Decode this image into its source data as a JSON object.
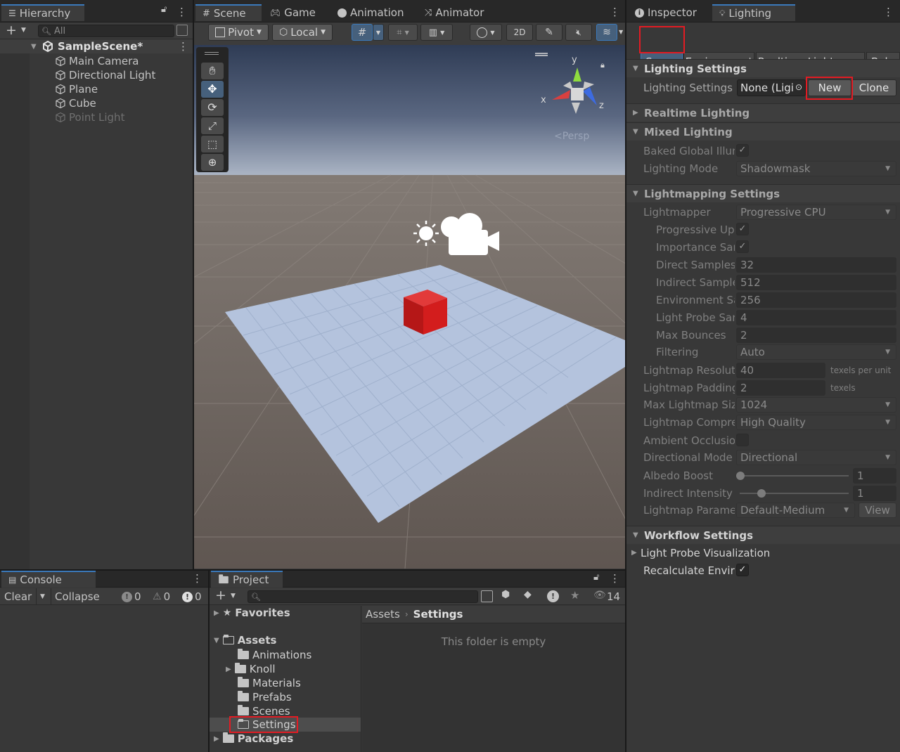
{
  "hierarchy": {
    "tab_label": "Hierarchy",
    "search_placeholder": "All",
    "scene_name": "SampleScene*",
    "items": [
      "Main Camera",
      "Directional Light",
      "Plane",
      "Cube",
      "Point Light"
    ]
  },
  "scene_tabs": {
    "scene": "Scene",
    "game": "Game",
    "animation": "Animation",
    "animator": "Animator"
  },
  "scene_toolbar": {
    "pivot": "Pivot",
    "local": "Local",
    "mode_2d": "2D"
  },
  "scene_view": {
    "persp_label": "<Persp",
    "axis_x": "x",
    "axis_y": "y",
    "axis_z": "z"
  },
  "inspector_tabs": {
    "inspector": "Inspector",
    "lighting": "Lighting"
  },
  "lighting": {
    "tabs": [
      "Scene",
      "Environment",
      "Realtime Lightmaps",
      "Bake"
    ],
    "sections": {
      "lighting_settings": "Lighting Settings",
      "realtime_lighting": "Realtime Lighting",
      "mixed_lighting": "Mixed Lighting",
      "lightmapping_settings": "Lightmapping Settings",
      "workflow_settings": "Workflow Settings"
    },
    "lighting_settings_asset": {
      "label": "Lighting Settings A",
      "value": "None (Ligi",
      "new_btn": "New",
      "clone_btn": "Clone"
    },
    "baked_gi_label": "Baked Global Illum",
    "lighting_mode": {
      "label": "Lighting Mode",
      "value": "Shadowmask"
    },
    "lightmapper": {
      "label": "Lightmapper",
      "value": "Progressive CPU"
    },
    "progressive_updates_label": "Progressive Up",
    "importance_sampling_label": "Importance Sar",
    "direct_samples": {
      "label": "Direct Samples",
      "value": "32"
    },
    "indirect_samples": {
      "label": "Indirect Sample",
      "value": "512"
    },
    "environment_samples": {
      "label": "Environment Sa",
      "value": "256"
    },
    "light_probe_samples": {
      "label": "Light Probe Sar",
      "value": "4"
    },
    "max_bounces": {
      "label": "Max Bounces",
      "value": "2"
    },
    "filtering": {
      "label": "Filtering",
      "value": "Auto"
    },
    "lightmap_resolution": {
      "label": "Lightmap Resoluti",
      "value": "40",
      "unit": "texels per unit"
    },
    "lightmap_padding": {
      "label": "Lightmap Padding",
      "value": "2",
      "unit": "texels"
    },
    "max_lightmap_size": {
      "label": "Max Lightmap Siz",
      "value": "1024"
    },
    "lightmap_compression": {
      "label": "Lightmap Compre",
      "value": "High Quality"
    },
    "ambient_occlusion_label": "Ambient Occlusior",
    "directional_mode": {
      "label": "Directional Mode",
      "value": "Directional"
    },
    "albedo_boost": {
      "label": "Albedo Boost",
      "value": "1",
      "slider_fraction": 0.0
    },
    "indirect_intensity": {
      "label": "Indirect Intensity",
      "value": "1",
      "slider_fraction": 0.2
    },
    "lightmap_parameters": {
      "label": "Lightmap Paramet",
      "value": "Default-Medium",
      "view_btn": "View"
    },
    "light_probe_viz_label": "Light Probe Visualization",
    "recalculate_env_label": "Recalculate Envir"
  },
  "console": {
    "tab_label": "Console",
    "clear_btn": "Clear",
    "collapse_btn": "Collapse",
    "log_count": "0",
    "warning_count": "0",
    "error_count": "0"
  },
  "project": {
    "tab_label": "Project",
    "hidden_count": "14",
    "favorites": "Favorites",
    "assets": "Assets",
    "asset_folders": [
      "Animations",
      "Knoll",
      "Materials",
      "Prefabs",
      "Scenes",
      "Settings"
    ],
    "packages": "Packages",
    "breadcrumb": [
      "Assets",
      "Settings"
    ],
    "empty_message": "This folder is empty"
  },
  "colors": {
    "accent": "#3a79bb",
    "highlight_box": "#e31b23",
    "cube": "#d31d1d",
    "plane": "#b4c3dd"
  }
}
